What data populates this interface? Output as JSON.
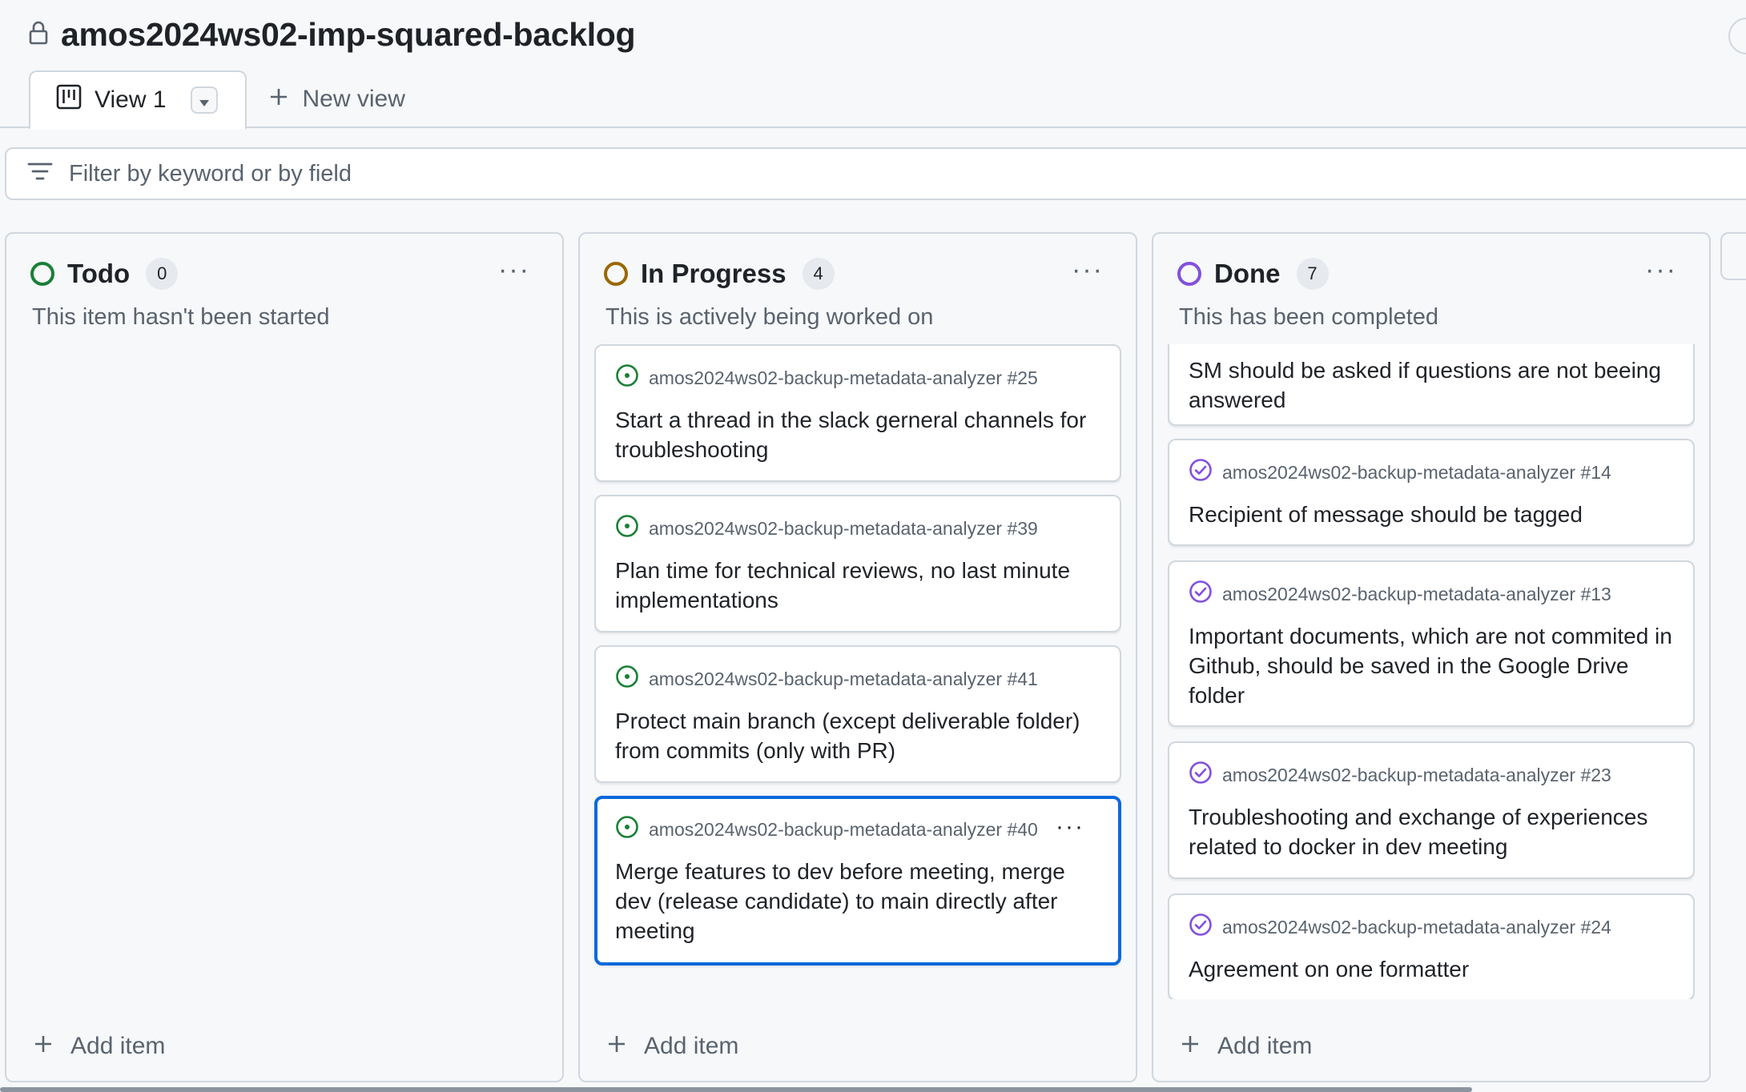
{
  "project": {
    "title": "amos2024ws02-imp-squared-backlog"
  },
  "tabs": [
    {
      "label": "View 1"
    },
    {
      "label": "New view"
    }
  ],
  "filter": {
    "placeholder": "Filter by keyword or by field"
  },
  "colors": {
    "todo": "#1a7f37",
    "in_progress": "#9a6700",
    "done": "#8250df",
    "accent": "#0969da"
  },
  "columns": [
    {
      "title": "Todo",
      "count": "0",
      "description": "This item hasn't been started",
      "add_label": "Add item",
      "cards": []
    },
    {
      "title": "In Progress",
      "count": "4",
      "description": "This is actively being worked on",
      "add_label": "Add item",
      "cards": [
        {
          "ref": "amos2024ws02-backup-metadata-analyzer #25",
          "title": "Start a thread in the slack gerneral channels for troubleshooting"
        },
        {
          "ref": "amos2024ws02-backup-metadata-analyzer #39",
          "title": "Plan time for technical reviews, no last minute implementations"
        },
        {
          "ref": "amos2024ws02-backup-metadata-analyzer #41",
          "title": "Protect main branch (except deliverable folder) from commits (only with PR)"
        },
        {
          "ref": "amos2024ws02-backup-metadata-analyzer #40",
          "title": "Merge features to dev before meeting, merge dev (release candidate) to main directly after meeting"
        }
      ]
    },
    {
      "title": "Done",
      "count": "7",
      "description": "This has been completed",
      "add_label": "Add item",
      "cards": [
        {
          "ref": "",
          "title": "SM should be asked if questions are not beeing answered"
        },
        {
          "ref": "amos2024ws02-backup-metadata-analyzer #14",
          "title": "Recipient of message should be tagged"
        },
        {
          "ref": "amos2024ws02-backup-metadata-analyzer #13",
          "title": "Important documents, which are not commited in Github, should be saved in the Google Drive folder"
        },
        {
          "ref": "amos2024ws02-backup-metadata-analyzer #23",
          "title": "Troubleshooting and exchange of experiences related to docker in dev meeting"
        },
        {
          "ref": "amos2024ws02-backup-metadata-analyzer #24",
          "title": "Agreement on one formatter"
        }
      ]
    }
  ]
}
